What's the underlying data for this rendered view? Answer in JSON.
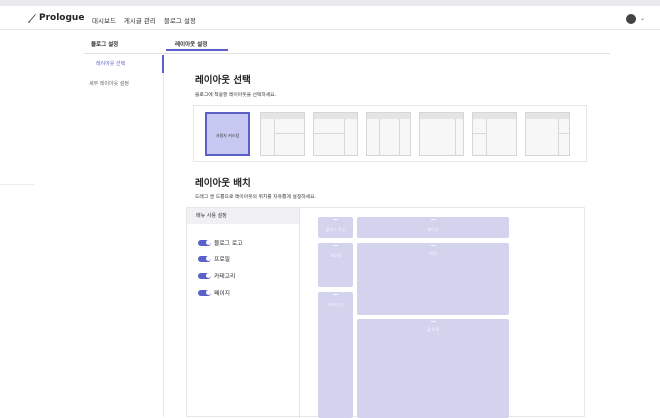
{
  "header": {
    "logo_text": "Prologue",
    "nav": [
      "대시보드",
      "게시글 관리",
      "블로그 설정"
    ],
    "chevron": "⌄"
  },
  "subnav": {
    "tabs": [
      "블로그 설정",
      "레이아웃 설정"
    ],
    "active_tab": "레이아웃 설정"
  },
  "sidebar": {
    "items": [
      {
        "label": "레이아웃 선택",
        "active": true
      },
      {
        "label": "세부 레이아웃 설정",
        "active": false
      }
    ]
  },
  "layout_select": {
    "title": "레이아웃 선택",
    "description": "블로그에 적용할 레이아웃을 선택하세요.",
    "custom_label": "사용자 커스텀"
  },
  "layout_arrange": {
    "title": "레이아웃 배치",
    "description": "드래그 앤 드롭으로 레이아웃의 위치를 자유롭게 설정하세요.",
    "menu_header": "메뉴 사용 설정",
    "toggles": [
      {
        "label": "블로그 로고",
        "on": true
      },
      {
        "label": "프로필",
        "on": true
      },
      {
        "label": "카테고리",
        "on": true
      },
      {
        "label": "페이지",
        "on": true
      }
    ],
    "blocks": {
      "logo": "블로그 로고",
      "page": "페이지",
      "profile": "프로필",
      "ad": "위젯",
      "category": "카테고리",
      "posts": "글 목록"
    }
  },
  "colors": {
    "accent": "#5b5fc7",
    "block": "#d3d3ee"
  }
}
